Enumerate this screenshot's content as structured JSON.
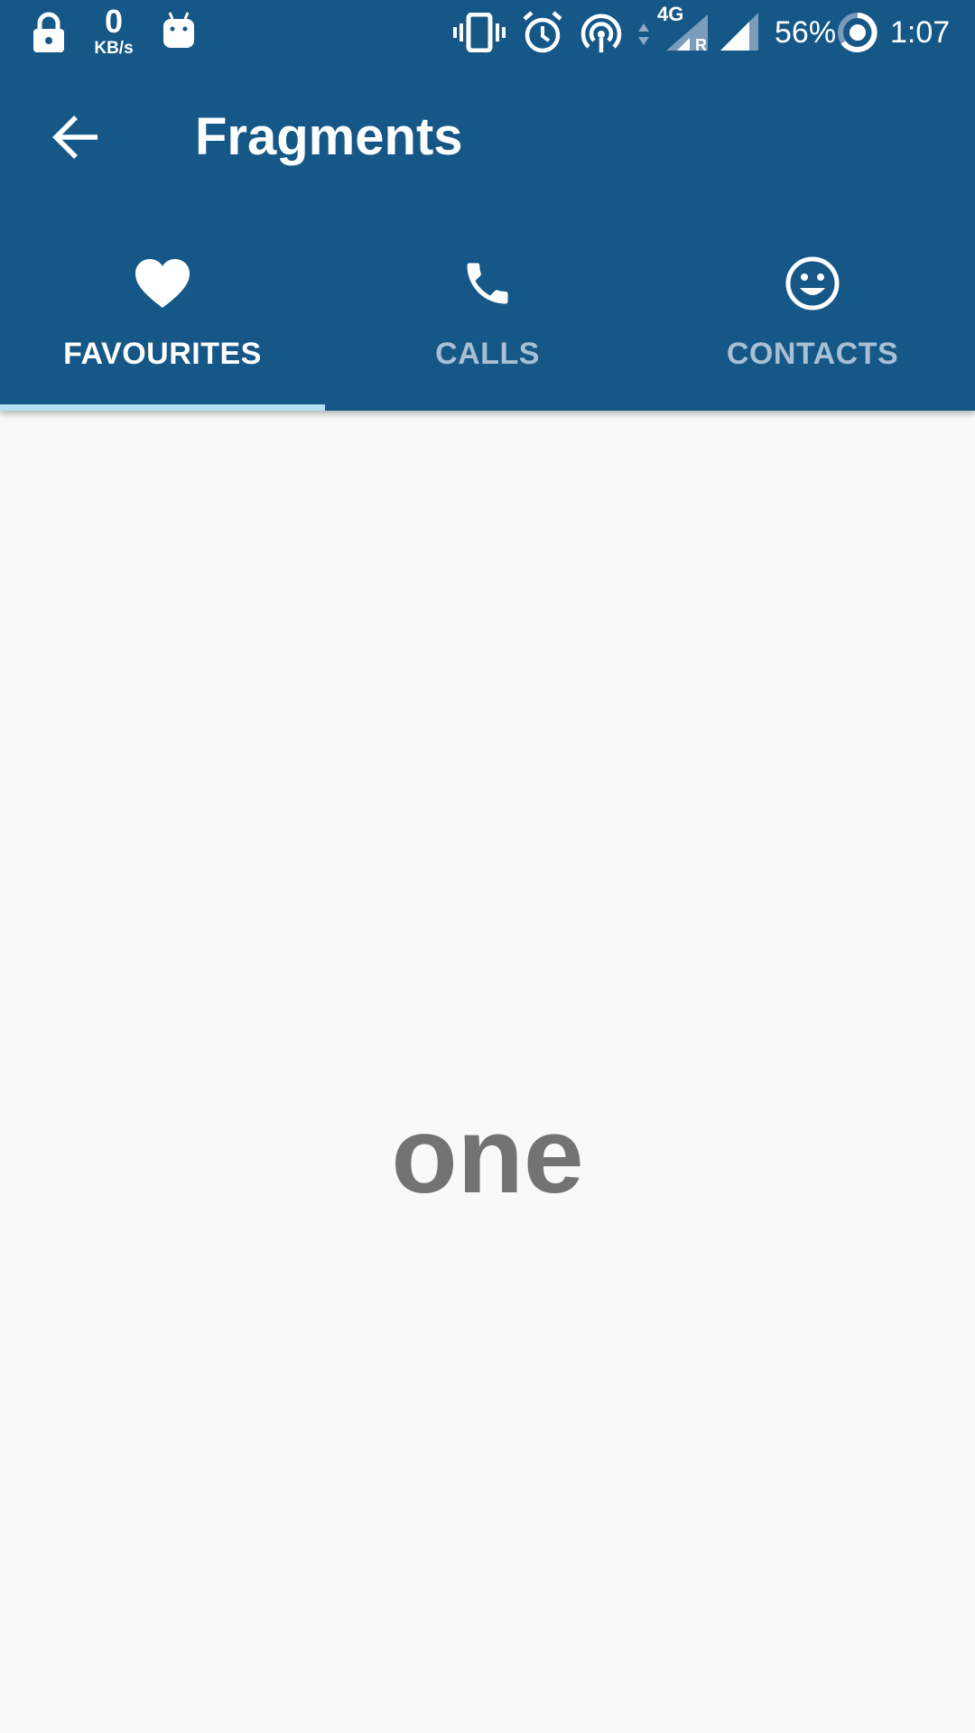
{
  "status_bar": {
    "network_speed_value": "0",
    "network_speed_unit": "KB/s",
    "network_type": "4G",
    "roaming_indicator": "R",
    "battery_percent": "56%",
    "time": "1:07",
    "icons": [
      "lock-icon",
      "android-icon",
      "vibrate-icon",
      "alarm-icon",
      "hotspot-icon",
      "data-arrows-icon",
      "signal-icon",
      "battery-saver-icon"
    ]
  },
  "toolbar": {
    "title": "Fragments",
    "back_icon": "arrow-back-icon"
  },
  "tabs": [
    {
      "label": "FAVOURITES",
      "icon": "heart-icon",
      "active": true
    },
    {
      "label": "CALLS",
      "icon": "phone-icon",
      "active": false
    },
    {
      "label": "CONTACTS",
      "icon": "smiley-icon",
      "active": false
    }
  ],
  "content": {
    "text": "one"
  },
  "colors": {
    "primary": "#155787",
    "indicator": "#b3e0f2",
    "tab_inactive": "#a9bfd3",
    "background": "#f9f9f9",
    "content_text": "#737373"
  }
}
